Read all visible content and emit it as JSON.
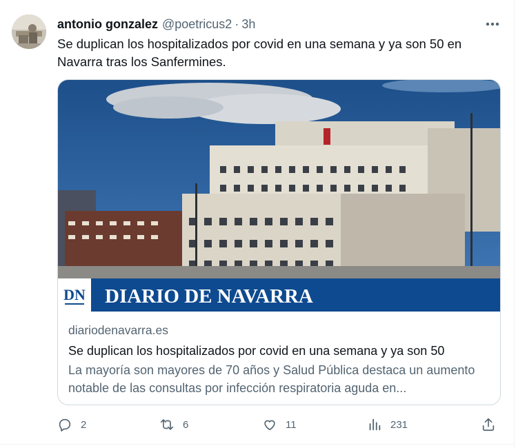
{
  "tweet": {
    "author_name": "antonio gonzalez",
    "handle": "@poetricus2",
    "separator": "·",
    "time": "3h",
    "text": "Se duplican los hospitalizados por covid en una semana y ya son 50 en Navarra tras los Sanfermines."
  },
  "card": {
    "logo_mark": "DN",
    "logo_text": "DIARIO DE NAVARRA",
    "domain": "diariodenavarra.es",
    "title": "Se duplican los hospitalizados por covid en una semana y ya son 50",
    "description": "La mayoría son mayores de 70 años y Salud Pública destaca un aumento notable de las consultas por infección respiratoria aguda en..."
  },
  "actions": {
    "replies": "2",
    "reposts": "6",
    "likes": "11",
    "views": "231"
  },
  "colors": {
    "text": "#0f1419",
    "secondary": "#536471",
    "border": "#cfd9de",
    "banner_blue": "#0e4a8f"
  },
  "icons": [
    "more-icon",
    "reply-icon",
    "repost-icon",
    "like-icon",
    "views-icon",
    "share-icon"
  ]
}
